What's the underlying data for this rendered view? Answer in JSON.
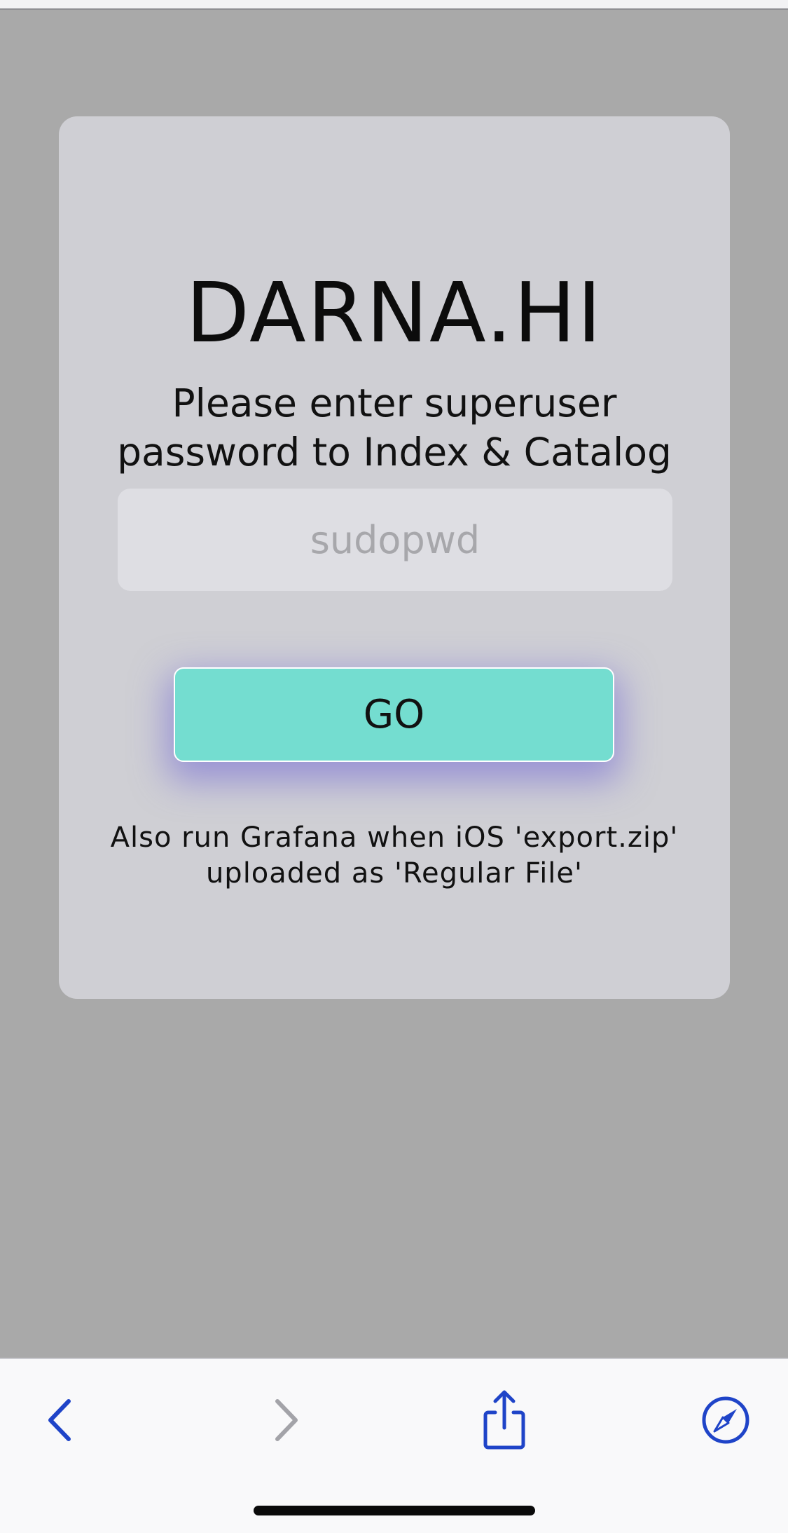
{
  "card": {
    "title": "DARNA.HI",
    "subtitle_line1": "Please enter superuser",
    "subtitle_line2": "password to Index & Catalog",
    "password_placeholder": "sudopwd",
    "password_value": "",
    "go_label": "GO",
    "note_line1": "Also run Grafana when iOS 'export.zip'",
    "note_line2": "uploaded as 'Regular File'"
  },
  "toolbar": {
    "items": [
      {
        "name": "back",
        "icon": "chevron-left-icon",
        "enabled": true
      },
      {
        "name": "forward",
        "icon": "chevron-right-icon",
        "enabled": false
      },
      {
        "name": "share",
        "icon": "share-icon",
        "enabled": true
      },
      {
        "name": "safari",
        "icon": "compass-icon",
        "enabled": true
      }
    ]
  },
  "colors": {
    "page_background": "#a9a9a9",
    "card_background": "#cfcfd4",
    "input_background": "#dedee3",
    "go_button": "#74ddd0",
    "go_shadow": "#6e62d6",
    "toolbar_accent": "#1f44c8",
    "toolbar_disabled": "#a3a3a8"
  }
}
